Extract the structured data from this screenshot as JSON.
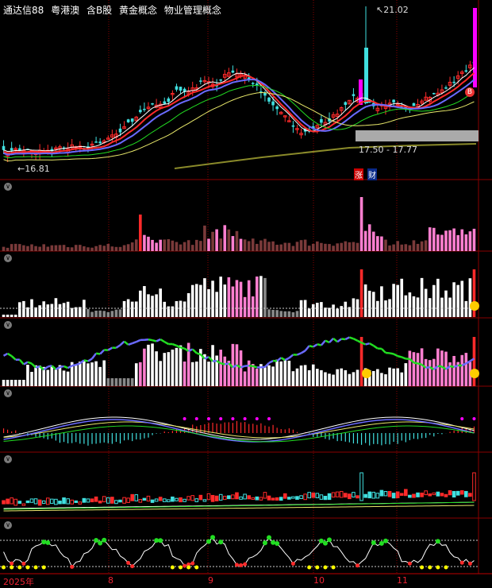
{
  "header": {
    "stock_name": "通达信88",
    "tags": [
      "粤港澳",
      "含B股",
      "黄金概念",
      "物业管理概念"
    ]
  },
  "price_panel": {
    "high_label": "21.02",
    "low_label": "16.81",
    "range_label": "17.50 - 17.77",
    "zhang_label": "涨",
    "cai_label": "财",
    "b_marker": "B"
  },
  "time_axis": {
    "year_label": "2025年",
    "months": [
      "8",
      "9",
      "10",
      "11"
    ]
  },
  "panel_toggles": [
    "∨",
    "∨",
    "∨",
    "∨",
    "∨",
    "∨",
    "∨"
  ],
  "colors": {
    "background": "#000000",
    "grid": "#8a0000",
    "up": "#ff2a2a",
    "down": "#40e0e0",
    "magenta": "#ff00ff",
    "pink": "#ff7fd0",
    "maroon": "#7a3a3a",
    "yellow": "#ffff00",
    "green": "#22dd22",
    "blue": "#6a6aff"
  }
}
